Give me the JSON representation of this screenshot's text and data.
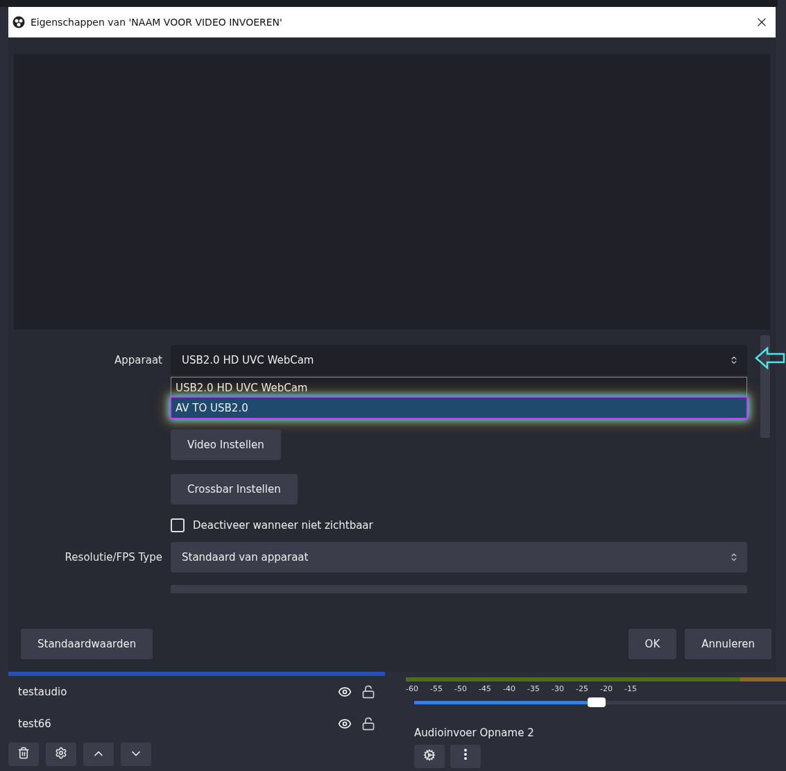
{
  "window": {
    "title": "Eigenschappen van 'NAAM VOOR VIDEO INVOEREN'"
  },
  "properties": {
    "device": {
      "label": "Apparaat",
      "value": "USB2.0 HD UVC WebCam",
      "options": [
        {
          "label": "USB2.0 HD UVC WebCam",
          "highlighted": false
        },
        {
          "label": "AV TO USB2.0",
          "highlighted": true
        }
      ]
    },
    "buttons": [
      "Video Instellen",
      "Crossbar Instellen"
    ],
    "checkbox": {
      "label": "Deactiveer wanneer niet zichtbaar",
      "checked": false
    },
    "resolution": {
      "label": "Resolutie/FPS Type",
      "value": "Standaard van apparaat"
    }
  },
  "footer": {
    "defaults": "Standaardwaarden",
    "ok": "OK",
    "cancel": "Annuleren"
  },
  "sources": [
    {
      "name": "testaudio",
      "visible": true,
      "locked": false
    },
    {
      "name": "test66",
      "visible": true,
      "locked": false
    }
  ],
  "mixer": {
    "ticks": [
      "-60",
      "-55",
      "-50",
      "-45",
      "-40",
      "-35",
      "-30",
      "-25",
      "-20",
      "-15"
    ],
    "level": 0.49,
    "channel": "Audioinvoer Opname 2"
  }
}
